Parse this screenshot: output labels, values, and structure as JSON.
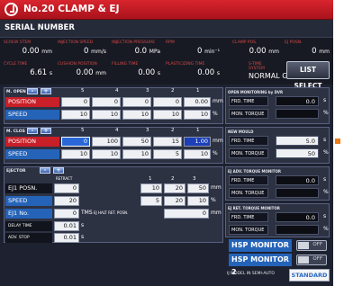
{
  "title": "No.20  CLAMP & EJ",
  "serial_label": "SERIAL NUMBER",
  "indicators_top": [
    {
      "label": "SCREW STEM",
      "value": "0.00",
      "unit": "mm"
    },
    {
      "label": "INJECTION SPEED",
      "value": "0",
      "unit": "mm/s"
    },
    {
      "label": "INJECTION PRESSURE",
      "value": "0.0",
      "unit": "MPa"
    },
    {
      "label": "RPM",
      "value": "0",
      "unit": "min⁻¹"
    },
    {
      "label": "CLAMP POS.",
      "value": "0.00",
      "unit": "mm"
    },
    {
      "label": "EJ POSN.",
      "value": "0",
      "unit": "mm"
    }
  ],
  "indicators_bottom": [
    {
      "label": "CYCLE TIME",
      "value": "6.61",
      "unit": "s"
    },
    {
      "label": "CUSHION POSITION",
      "value": "0.00",
      "unit": "mm"
    },
    {
      "label": "FILLING TIME",
      "value": "0.00",
      "unit": "s"
    },
    {
      "label": "PLASTICIZING TIME",
      "value": "0.00",
      "unit": "s"
    }
  ],
  "mode": {
    "label": "S-TIME SYSTEM",
    "value": "NORMAL GEAR"
  },
  "list_select": "LIST SELECT",
  "mold_open": {
    "header": "M. OPEN",
    "stages": [
      "5",
      "4",
      "3",
      "2",
      "1"
    ],
    "position_label": "POSITION",
    "position": [
      "0",
      "0",
      "0",
      "0",
      "0.00"
    ],
    "position_unit": "mm",
    "speed_label": "SPEED",
    "speed": [
      "10",
      "10",
      "10",
      "10",
      "10"
    ],
    "speed_unit": "%"
  },
  "mold_close": {
    "header": "M. CLOS",
    "stages": [
      "5",
      "4",
      "3",
      "2",
      "1"
    ],
    "position_label": "POSITION",
    "position": [
      "0",
      "100",
      "50",
      "15",
      "1.00"
    ],
    "position_unit": "mm",
    "speed_label": "SPEED",
    "speed": [
      "10",
      "10",
      "10",
      "5",
      "10"
    ],
    "speed_unit": "%"
  },
  "ejector": {
    "header": "EJECTOR",
    "retract_label": "RETRACT",
    "stages": [
      "1",
      "2",
      "3"
    ],
    "posn_label": "EJ1 POSN.",
    "posn_retract": "0",
    "posn": [
      "10",
      "20",
      "50"
    ],
    "posn_unit": "mm",
    "speed_label": "SPEED",
    "speed_retract": "20",
    "speed": [
      "5",
      "20",
      "10"
    ],
    "speed_unit": "%",
    "no_label": "EJ1 No.",
    "no_value": "0",
    "no_unit": "TMS",
    "auto_label": "EJ HALT RET. POSN.",
    "auto_value": "0",
    "auto_unit": "mm",
    "delay_label": "DELAY TIME",
    "delay_value": "0.01",
    "adv_label": "ADV. STOP",
    "adv_value": "0.01",
    "time_unit": "s"
  },
  "side_sections": [
    {
      "header": "OPEN MONITORING by DVR",
      "row1_label": "FRD. TIME",
      "row1_value": "0.0",
      "row2_label": "MON. TORQUE",
      "row2_value": "",
      "unit1": "s",
      "unit2": "%"
    },
    {
      "header": "NEW MOULD",
      "row1_label": "FRD. TIME",
      "row1_value": "5.0",
      "row2_label": "MON. TORQUE",
      "row2_value": "50",
      "unit1": "s",
      "unit2": "%"
    },
    {
      "header": "EJ ADV. TORQUE MONITOR",
      "row1_label": "FRD. TIME",
      "row1_value": "0.0",
      "row2_label": "MON. TORQUE",
      "row2_value": "",
      "unit1": "s",
      "unit2": "%"
    },
    {
      "header": "EJ RET. TORQUE MONITOR",
      "row1_label": "FRD. TIME",
      "row1_value": "0.0",
      "row2_label": "MON. TORQUE",
      "row2_value": "",
      "unit1": "s",
      "unit2": "%"
    }
  ],
  "hsp_monitor": {
    "label": "HSP MONITOR",
    "state": "OFF"
  },
  "hsp_monitor2": {
    "label": "HSP MONITOR 2",
    "state": "OFF"
  },
  "semi_auto": {
    "label": "IJ MODEL IN SEMI-AUTO",
    "button": "STANDARD"
  },
  "colors": {
    "title_red": "#c81f29",
    "position_blue": "#2a68d8",
    "panel": "#1e2230",
    "marker_orange": "#ef7d1a"
  }
}
